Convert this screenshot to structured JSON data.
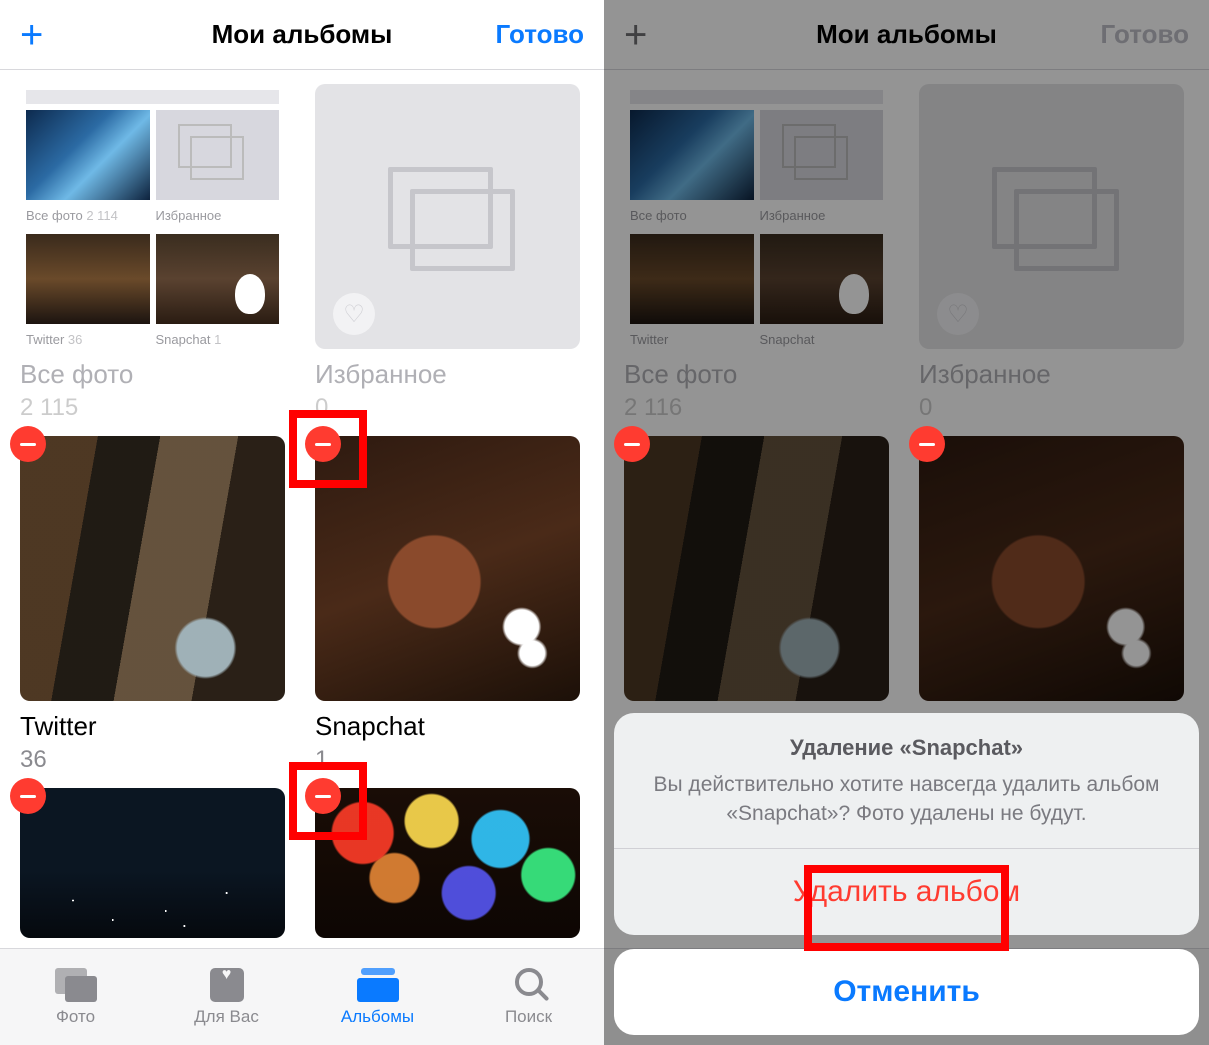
{
  "header": {
    "title": "Мои альбомы",
    "add_label": "+",
    "done_label": "Готово"
  },
  "collage": {
    "l1": "Все фото",
    "c1": "2 114",
    "l2": "Избранное",
    "l3": "Twitter",
    "c3": "36",
    "l4": "Snapchat",
    "c4": "1"
  },
  "albums_left": {
    "a1": {
      "name": "Все фото",
      "count": "2 115"
    },
    "a2": {
      "name": "Избранное",
      "count": "0"
    },
    "a3": {
      "name": "Twitter",
      "count": "36"
    },
    "a4": {
      "name": "Snapchat",
      "count": "1"
    }
  },
  "albums_right": {
    "a1": {
      "name": "Все фото",
      "count": "2 116"
    },
    "a2": {
      "name": "Избранное",
      "count": "0"
    }
  },
  "tabs": {
    "photos": "Фото",
    "foryou": "Для Вас",
    "albums": "Альбомы",
    "search": "Поиск"
  },
  "sheet": {
    "title": "Удаление «Snapchat»",
    "message": "Вы действительно хотите навсегда удалить альбом «Snapchat»? Фото удалены не будут.",
    "delete": "Удалить альбом",
    "cancel": "Отменить"
  }
}
